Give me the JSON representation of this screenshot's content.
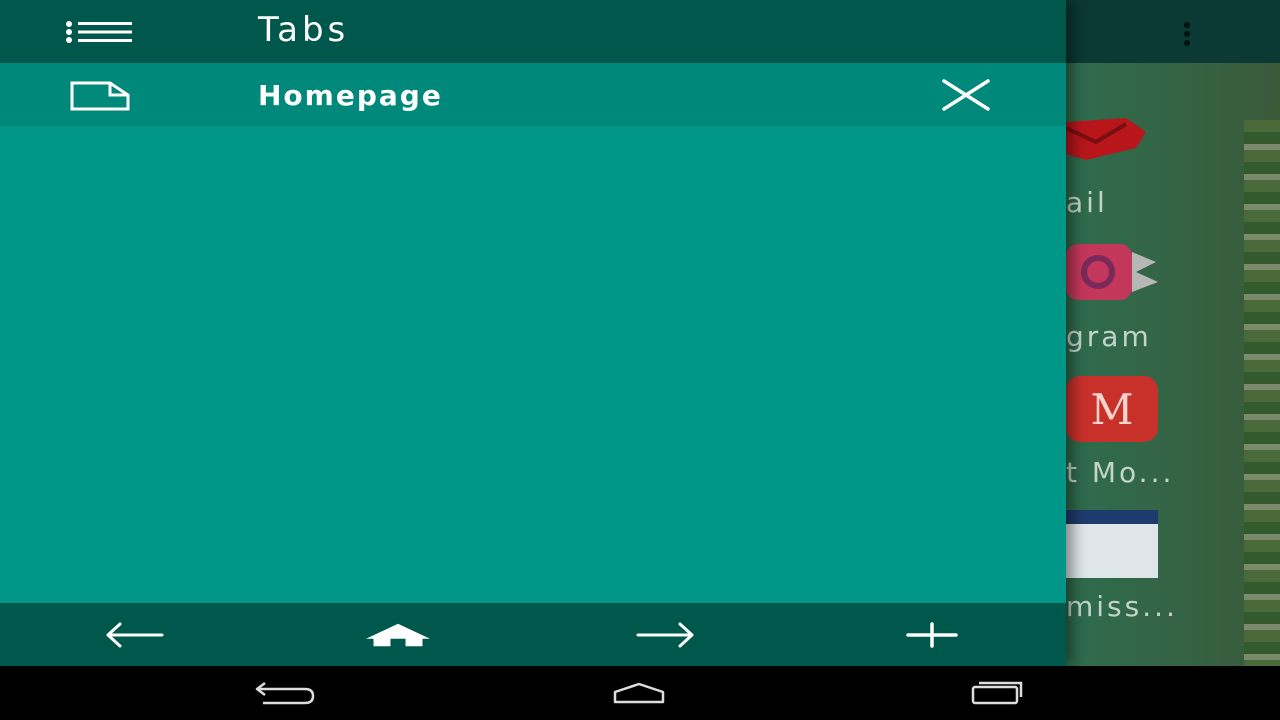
{
  "drawer": {
    "title": "Tabs",
    "header_icon": "list-icon",
    "tabs": [
      {
        "label": "Homepage",
        "icon": "page-icon",
        "close_icon": "close-icon"
      }
    ],
    "footer": {
      "back_icon": "arrow-left-icon",
      "home_icon": "home-icon",
      "forward_icon": "arrow-right-icon",
      "new_tab_icon": "plus-icon"
    }
  },
  "background": {
    "menu_icon": "more-vertical-icon",
    "shortcuts": [
      {
        "label": "ail"
      },
      {
        "label": "gram"
      },
      {
        "label": "t Mo..."
      },
      {
        "label": "miss..."
      }
    ]
  },
  "system_nav": {
    "back_icon": "system-back-icon",
    "home_icon": "system-home-icon",
    "recents_icon": "system-recents-icon"
  },
  "colors": {
    "drawer_bg": "#009688",
    "drawer_header": "#00574b",
    "tab_row": "#00897b",
    "nav_bar": "#000000"
  }
}
